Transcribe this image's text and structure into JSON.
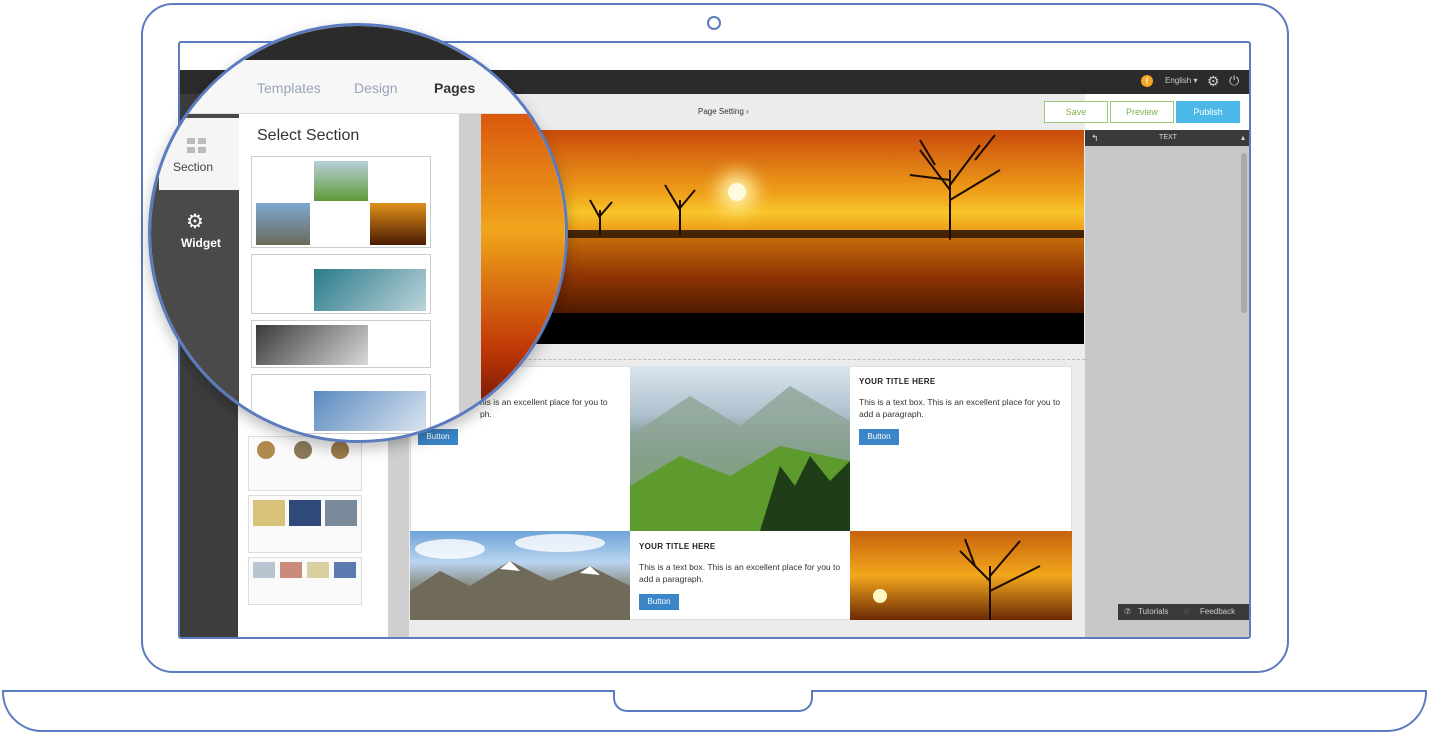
{
  "topbar": {
    "language": "English ▾",
    "warning_glyph": "!",
    "gear_glyph": "⚙",
    "power_glyph": "⏻"
  },
  "tabs": [
    {
      "label": "Templates",
      "active": false
    },
    {
      "label": "Design",
      "active": false
    },
    {
      "label": "Pages",
      "active": true
    }
  ],
  "sidebar": {
    "section_label": "Section",
    "widget_label": "Widget"
  },
  "panel": {
    "title": "Select Section"
  },
  "toolbar": {
    "page_setting": "Page Setting ›",
    "save": "Save",
    "preview": "Preview",
    "publish": "Publish"
  },
  "right_panel": {
    "header": "TEXT",
    "back_glyph": "↰",
    "collapse_glyph": "▴",
    "tutorials": "Tutorials",
    "feedback": "Feedback",
    "tutorials_glyph": "⑦",
    "feedback_glyph": "◌"
  },
  "canvas": {
    "block1": {
      "partial_text_1": "his is an excellent place for you to",
      "partial_text_2": "ph.",
      "button": "Button"
    },
    "block2": {
      "title": "YOUR TITLE HERE",
      "body": "This is a text box. This is an excellent place for you to add a paragraph.",
      "button": "Button"
    },
    "block3": {
      "title": "YOUR TITLE HERE",
      "body": "This is a text box. This is an excellent place for you to add a paragraph.",
      "button": "Button"
    }
  },
  "colors": {
    "accent_blue": "#3a86c8",
    "publish_blue": "#4cb8e8",
    "save_green": "#7bb24f",
    "outline_blue": "#5a7bbf",
    "topbar_dark": "#2b2b2b"
  }
}
